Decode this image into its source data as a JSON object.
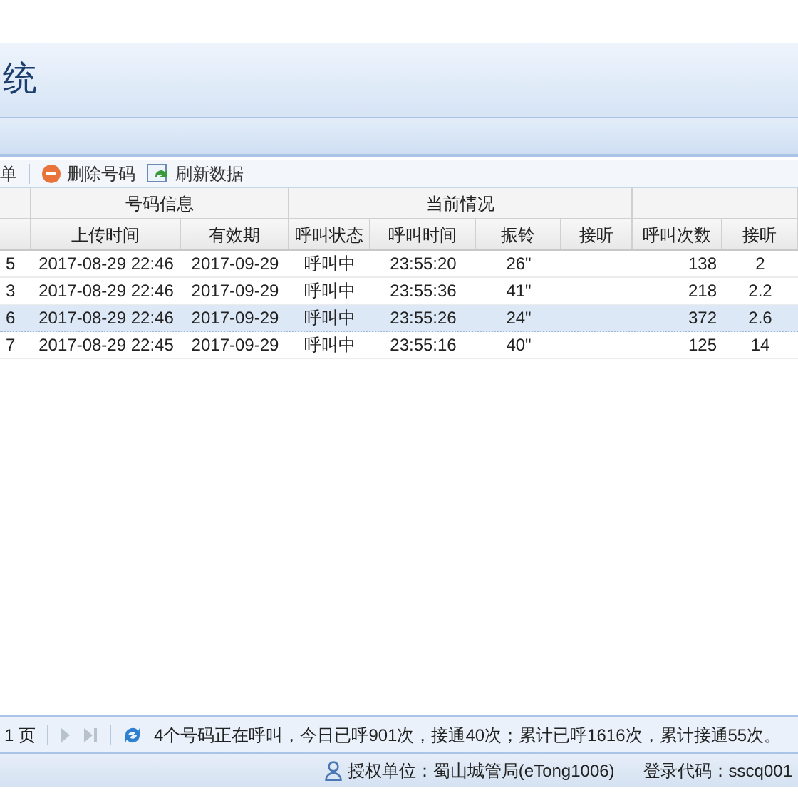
{
  "header": {
    "title": "统"
  },
  "toolbar": {
    "items": [
      {
        "kind": "text",
        "label": "单"
      },
      {
        "kind": "delete",
        "label": "删除号码"
      },
      {
        "kind": "refresh",
        "label": "刷新数据"
      }
    ]
  },
  "table": {
    "groups": [
      "号码信息",
      "当前情况"
    ],
    "columns": [
      "",
      "上传时间",
      "有效期",
      "呼叫状态",
      "呼叫时间",
      "振铃",
      "接听",
      "呼叫次数",
      "接听"
    ],
    "rows": [
      {
        "selected": false,
        "cells": [
          "5",
          "2017-08-29 22:46",
          "2017-09-29",
          "呼叫中",
          "23:55:20",
          "26\"",
          "",
          "138",
          "2"
        ]
      },
      {
        "selected": false,
        "cells": [
          "3",
          "2017-08-29 22:46",
          "2017-09-29",
          "呼叫中",
          "23:55:36",
          "41\"",
          "",
          "218",
          "2.2"
        ]
      },
      {
        "selected": true,
        "cells": [
          "6",
          "2017-08-29 22:46",
          "2017-09-29",
          "呼叫中",
          "23:55:26",
          "24\"",
          "",
          "372",
          "2.6"
        ]
      },
      {
        "selected": false,
        "cells": [
          "7",
          "2017-08-29 22:45",
          "2017-09-29",
          "呼叫中",
          "23:55:16",
          "40\"",
          "",
          "125",
          "14"
        ]
      }
    ]
  },
  "pager": {
    "page": "1 页",
    "status": "4个号码正在呼叫，今日已呼901次，接通40次；累计已呼1616次，累计接通55次。"
  },
  "footer": {
    "unit": "授权单位：蜀山城管局(eTong1006)",
    "login": "登录代码：sscq001"
  }
}
